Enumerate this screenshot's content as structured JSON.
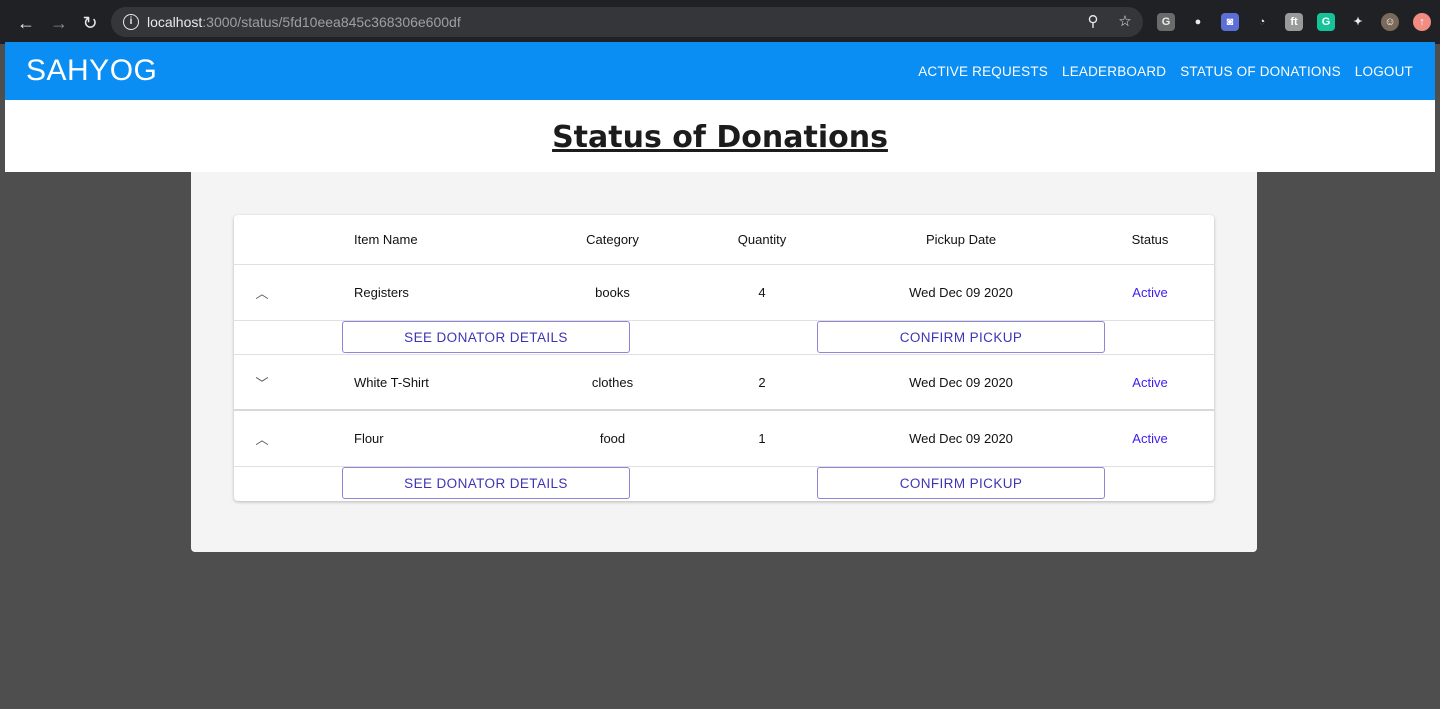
{
  "browser": {
    "url_host": "localhost",
    "url_path": ":3000/status/5fd10eea845c368306e600df",
    "extensions": [
      {
        "name": "grammarly-g-icon",
        "glyph": "G",
        "bg": "#6b6b6b",
        "fg": "#e8eaed"
      },
      {
        "name": "circle-ext-icon",
        "glyph": "●",
        "bg": "#202124",
        "fg": "#e8eaed"
      },
      {
        "name": "camera-ext-icon",
        "glyph": "◙",
        "bg": "#5b6fd6",
        "fg": "#ffffff"
      },
      {
        "name": "clock-ext-icon",
        "glyph": "◔",
        "bg": "#202124",
        "fg": "#e8eaed"
      },
      {
        "name": "font-ext-icon",
        "glyph": "ft",
        "bg": "#9a9a9a",
        "fg": "#ffffff"
      },
      {
        "name": "grammarly-green-icon",
        "glyph": "G",
        "bg": "#15c39a",
        "fg": "#ffffff"
      },
      {
        "name": "puzzle-extensions-icon",
        "glyph": "✦",
        "bg": "#202124",
        "fg": "#e8eaed"
      },
      {
        "name": "profile-avatar-icon",
        "glyph": "☺",
        "bg": "#7a6a5a",
        "fg": "#ffffff"
      },
      {
        "name": "update-icon",
        "glyph": "↑",
        "bg": "#f28b82",
        "fg": "#ffffff"
      }
    ]
  },
  "app": {
    "brand": "SAHYOG",
    "nav": [
      "ACTIVE REQUESTS",
      "LEADERBOARD",
      "STATUS OF DONATIONS",
      "LOGOUT"
    ],
    "page_title": "Status of Donations",
    "accent": "#0a8ef3"
  },
  "table": {
    "headers": [
      "Item Name",
      "Category",
      "Quantity",
      "Pickup Date",
      "Status"
    ],
    "rows": [
      {
        "name": "Registers",
        "category": "books",
        "quantity": "4",
        "date": "Wed Dec 09 2020",
        "status": "Active",
        "expanded": true
      },
      {
        "name": "White T-Shirt",
        "category": "clothes",
        "quantity": "2",
        "date": "Wed Dec 09 2020",
        "status": "Active",
        "expanded": false
      },
      {
        "name": "Flour",
        "category": "food",
        "quantity": "1",
        "date": "Wed Dec 09 2020",
        "status": "Active",
        "expanded": true
      }
    ],
    "buttons": {
      "details": "SEE DONATOR DETAILS",
      "confirm": "CONFIRM PICKUP"
    }
  }
}
